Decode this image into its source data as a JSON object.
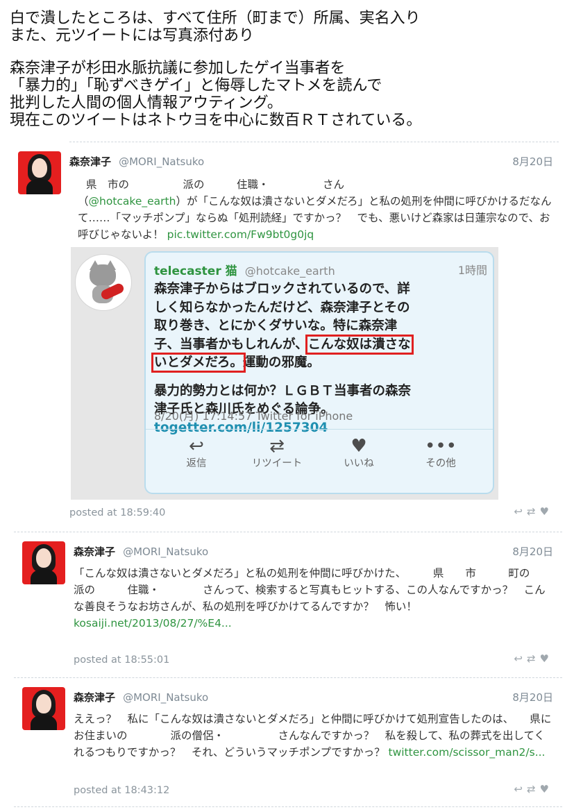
{
  "caption": {
    "line1": "白で潰したところは、すべて住所（町まで）所属、実名入り",
    "line2": "また、元ツイートには写真添付あり",
    "line3": "森奈津子が杉田水脈抗議に参加したゲイ当事者を",
    "line4": "「暴力的」「恥ずべきゲイ」と侮辱したマトメを読んで",
    "line5": "批判した人間の個人情報アウティング。",
    "line6": "現在このツイートはネトウヨを中心に数百ＲＴされている。"
  },
  "tweets": [
    {
      "name": "森奈津子",
      "handle": "@MORI_Natsuko",
      "date": "8月20日",
      "text_a": "県　市の　　　　　派の　　　住職・　　　　　さん",
      "text_b": "（",
      "link1": "@hotcake_earth",
      "text_c": "）が「こんな奴は潰さないとダメだろ」と私の処刑を仲間に呼びかけるだなんて……「マッチポンプ」ならぬ「処刑読経」ですかっ？　でも、悪いけど森家は日蓮宗なので、お呼びじゃないよ！ ",
      "link2": "pic.twitter.com/Fw9bt0g0jq",
      "posted": "posted at 18:59:40"
    },
    {
      "name": "森奈津子",
      "handle": "@MORI_Natsuko",
      "date": "8月20日",
      "text": "「こんな奴は潰さないとダメだろ」と私の処刑を仲間に呼びかけた、　　　県　　市　　　町の　　　　　派の　　　住職・　　　　さんって、検索すると写真もヒットする、この人なんですかっ？　こんな善良そうなお坊さんが、私の処刑を呼びかけてるんですか？　怖い！",
      "link": "kosaiji.net/2013/08/27/%E4...",
      "posted": "posted at 18:55:01"
    },
    {
      "name": "森奈津子",
      "handle": "@MORI_Natsuko",
      "date": "8月20日",
      "text": "ええっ？　私に「こんな奴は潰さないとダメだろ」と仲間に呼びかけて処刑宣告したのは、　　県にお住まいの　　　　派の僧侶・　　　　　さんなんですかっ？　私を殺して、私の葬式を出してくれるつもりですかっ？　それ、どういうマッチポンプですかっ？ ",
      "link": "twitter.com/scissor_man2/s...",
      "posted": "posted at 18:43:12"
    }
  ],
  "embedded": {
    "name": "telecaster 猫",
    "handle": "@hotcake_earth",
    "time": "1時間",
    "text_a": "森奈津子からはブロックされているので、詳しく知らなかったんだけど、森奈津子とその取り巻き、とにかくダサいな。特に森奈津子、当事者かもしれんが、",
    "highlight": "こんな奴は潰さないとダメだろ。",
    "text_b": "運動の邪魔。",
    "text_c": "暴力的勢力とは何か？ＬＧＢＴ当事者の森奈津子氏と森川氏をめぐる論争。",
    "link": "togetter.com/li/1257304",
    "meta": "8/20(月) 17:14:57 Twitter for iPhone",
    "actions": [
      {
        "icon": "reply-icon",
        "glyph": "↩",
        "label": "返信"
      },
      {
        "icon": "retweet-icon",
        "glyph": "⇄",
        "label": "リツイート"
      },
      {
        "icon": "heart-icon",
        "glyph": "♥",
        "label": "いいね"
      },
      {
        "icon": "more-icon",
        "glyph": "•••",
        "label": "その他"
      }
    ]
  },
  "footer_icons": {
    "reply": "↩",
    "retweet": "⇄",
    "like": "♥"
  }
}
